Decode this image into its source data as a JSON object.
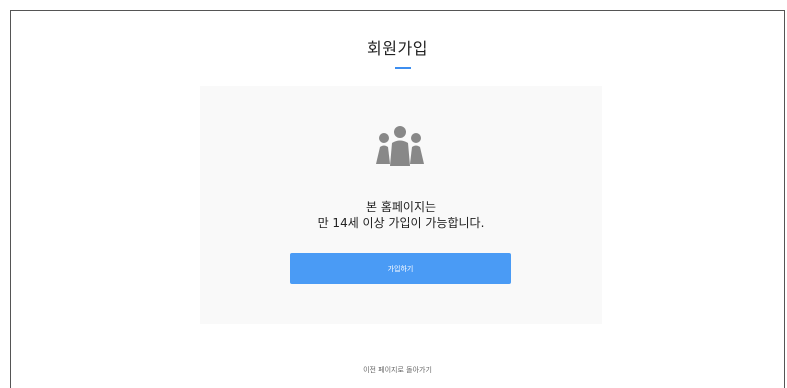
{
  "header": {
    "title": "회원가입"
  },
  "notice": {
    "icon": "people-group-icon",
    "line1": "본 홈페이지는",
    "line2": "만 14세 이상 가입이 가능합니다."
  },
  "actions": {
    "join_label": "가입하기",
    "back_label": "이전 페이지로 돌아가기"
  },
  "colors": {
    "accent": "#4a9bf5",
    "panel_background": "#f9f9f9",
    "icon": "#888888"
  }
}
